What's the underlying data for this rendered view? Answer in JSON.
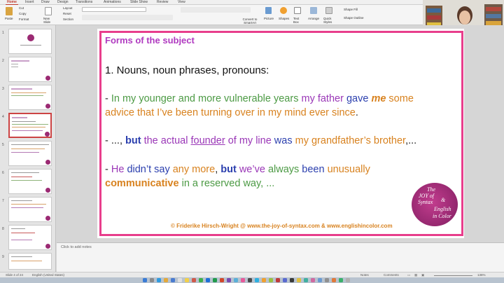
{
  "ribbon": {
    "tabs": [
      "Home",
      "Insert",
      "Draw",
      "Design",
      "Transitions",
      "Animations",
      "Slide Show",
      "Review",
      "View"
    ],
    "active_tab": "Home",
    "paste_label": "Paste",
    "cut_label": "Cut",
    "copy_label": "Copy",
    "format_label": "Format",
    "new_slide_label": "New Slide",
    "layout_label": "Layout",
    "reset_label": "Reset",
    "section_label": "Section",
    "convert_label": "Convert to SmartArt",
    "picture_label": "Picture",
    "shapes_label": "Shapes",
    "textbox_label": "Text Box",
    "arrange_label": "Arrange",
    "quick_styles_label": "Quick Styles",
    "shape_fill_label": "Shape Fill",
    "shape_outline_label": "Shape Outline"
  },
  "thumbnails": {
    "numbers": [
      "1",
      "2",
      "3",
      "4",
      "5",
      "6",
      "7",
      "8",
      "9"
    ],
    "selected": "4"
  },
  "slide": {
    "subject_title": "Forms of the subject",
    "heading": "1. Nouns, noun phrases, pronouns:",
    "line1": {
      "dash": "- ",
      "a": "In my younger and more vulnerable years ",
      "b": "my father ",
      "c": "gave ",
      "d": "me",
      "e": " some"
    },
    "line2": {
      "a": "advice that I’ve been turning over in my mind ever since",
      "b": "."
    },
    "line3": {
      "dash": "-  ..., ",
      "but": "but ",
      "a": "the actual ",
      "founder": "founder",
      "b": " of my line ",
      "c": "was ",
      "d": "my grandfather’s brother",
      "e": ",..."
    },
    "line4": {
      "dash": "- ",
      "he": "He ",
      "a": "didn’t say ",
      "b": "any more",
      "c": ", ",
      "but": "but ",
      "we": "we’ve ",
      "d": "always ",
      "e": "been ",
      "f": "unusually"
    },
    "line5": {
      "a": "communicative",
      "b": " in a reserved way, ..."
    },
    "copyright": "© Friderike Hirsch-Wright @  www.the-joy-of-syntax.com  & www.englishincolor.com",
    "logo": {
      "l1": "The",
      "l2": "JOY of",
      "l3": "Syntax",
      "amp": "&",
      "l4": "English",
      "l5": "in Color"
    }
  },
  "notes": {
    "placeholder": "Click to add notes"
  },
  "status": {
    "slide_counter": "Slide 4 of 24",
    "language": "English (United States)",
    "notes_label": "Notes",
    "comments_label": "Comments",
    "zoom": "136%"
  },
  "colors": {
    "frame": "#e83e8c",
    "subject": "#b03ac0",
    "green": "#4c9a44",
    "purple": "#9a37b7",
    "orange": "#d8821f",
    "blue": "#2b3fae",
    "red": "#c7352e"
  }
}
